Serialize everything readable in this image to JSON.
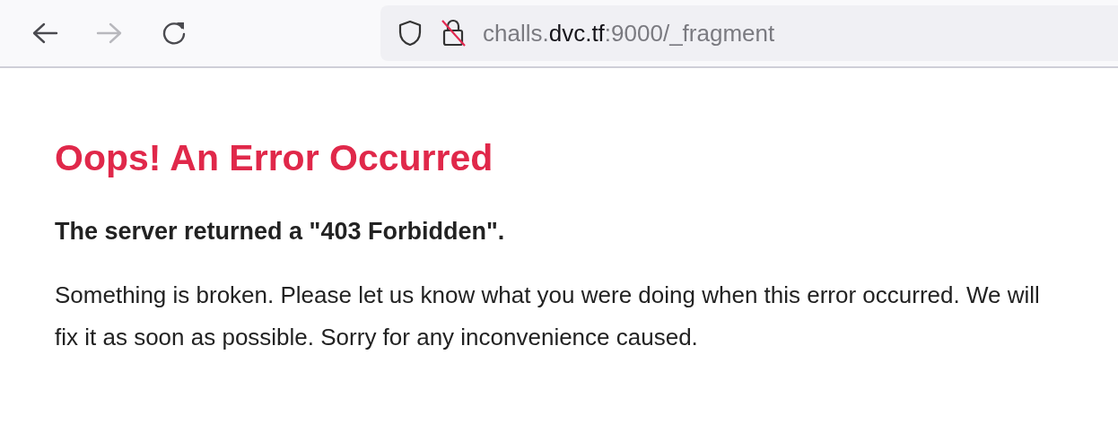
{
  "toolbar": {
    "back": {
      "disabled": false
    },
    "forward": {
      "disabled": true
    },
    "url": {
      "prefix": "challs.",
      "host": "dvc.tf",
      "suffix": ":9000/_fragment"
    }
  },
  "page": {
    "title": "Oops! An Error Occurred",
    "subtitle": "The server returned a \"403 Forbidden\".",
    "message": "Something is broken. Please let us know what you were doing when this error occurred. We will fix it as soon as possible. Sorry for any inconvenience caused."
  }
}
